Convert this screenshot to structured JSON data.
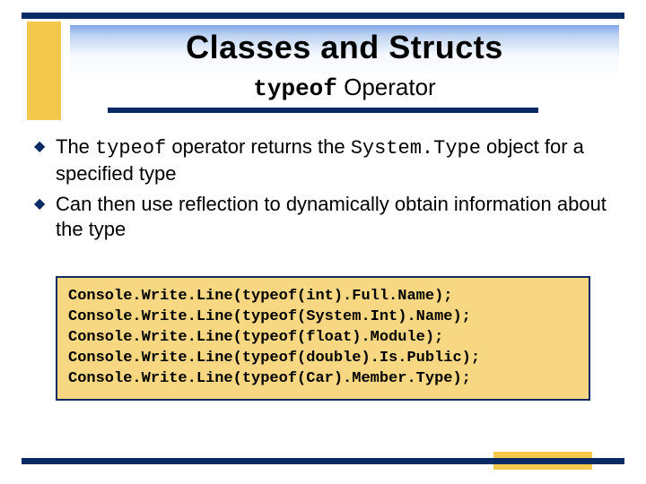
{
  "title": {
    "main": "Classes and Structs",
    "sub_keyword": "typeof",
    "sub_rest": " Operator"
  },
  "bullets": [
    {
      "pre": "The ",
      "kw1": "typeof",
      "mid": " operator returns the ",
      "kw2": "System.Type",
      "post": " object for a specified type"
    },
    {
      "pre": "Can then use reflection to dynamically obtain information about the type",
      "kw1": "",
      "mid": "",
      "kw2": "",
      "post": ""
    }
  ],
  "code": "Console.Write.Line(typeof(int).Full.Name);\nConsole.Write.Line(typeof(System.Int).Name);\nConsole.Write.Line(typeof(float).Module);\nConsole.Write.Line(typeof(double).Is.Public);\nConsole.Write.Line(typeof(Car).Member.Type);"
}
